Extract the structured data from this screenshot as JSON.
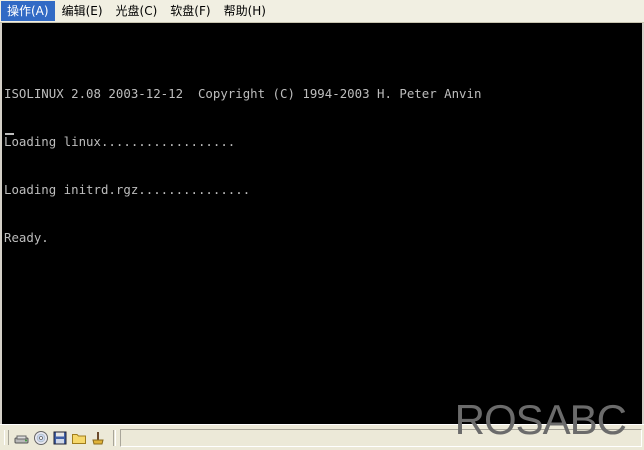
{
  "menubar": {
    "items": [
      {
        "label": "操作(A)",
        "active": true
      },
      {
        "label": "编辑(E)",
        "active": false
      },
      {
        "label": "光盘(C)",
        "active": false
      },
      {
        "label": "软盘(F)",
        "active": false
      },
      {
        "label": "帮助(H)",
        "active": false
      }
    ]
  },
  "console": {
    "lines": [
      "ISOLINUX 2.08 2003-12-12  Copyright (C) 1994-2003 H. Peter Anvin",
      "Loading linux..................",
      "Loading initrd.rgz...............",
      "Ready."
    ],
    "text_color": "#bdbdbd",
    "background": "#000000"
  },
  "statusbar": {
    "icons": [
      "network-icon",
      "cdrom-icon",
      "floppy-icon",
      "folder-icon",
      "usb-icon"
    ]
  },
  "watermark": {
    "text": "ROSABC"
  }
}
